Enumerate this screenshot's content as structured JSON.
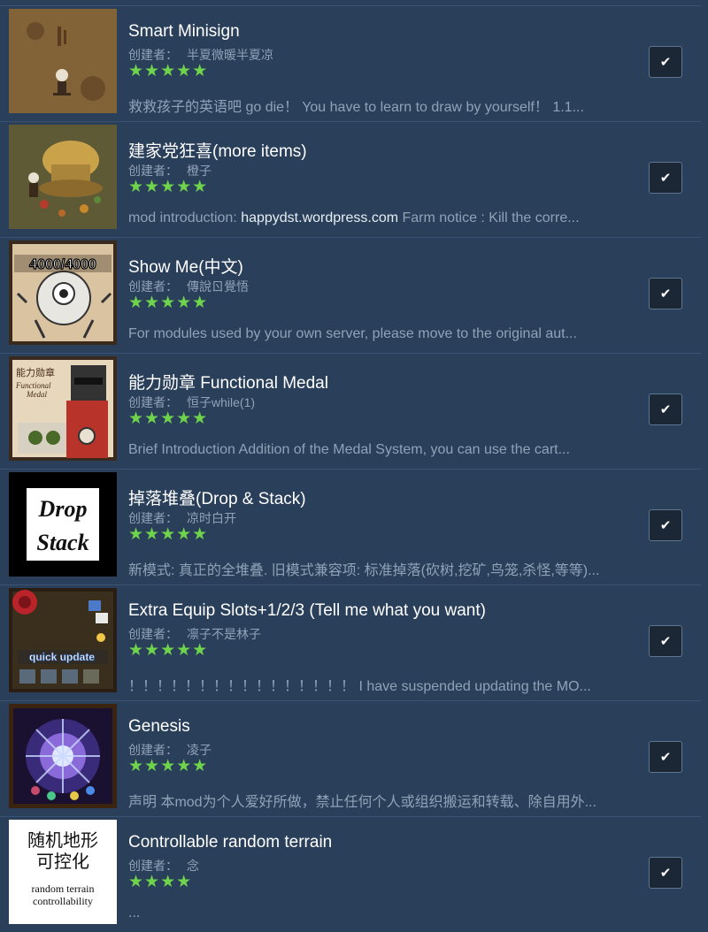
{
  "author_label": "创建者：",
  "check_glyph": "✔",
  "items": [
    {
      "title": "Smart Minisign",
      "author": "半夏微暖半夏凉",
      "stars": "★★★★★",
      "desc": "救救孩子的英语吧 go die！ You have to learn to draw by yourself！ 1.1...",
      "checked": true
    },
    {
      "title": "建家党狂喜(more items)",
      "author": "橙子",
      "stars": "★★★★★",
      "desc_prefix": "mod introduction: ",
      "desc_link": "happydst.wordpress.com",
      "desc_suffix": " Farm notice : Kill the corre...",
      "checked": true
    },
    {
      "title": "Show Me(中文)",
      "author": "傳說ㄖ覺悟",
      "stars": "★★★★★",
      "thumb_text": "4000/4000",
      "desc": "For modules used by your own server, please move to the original aut...",
      "checked": true
    },
    {
      "title": "能力勋章 Functional Medal",
      "author": "恒子while(1)",
      "stars": "★★★★★",
      "thumb_text_1": "能力勋章",
      "thumb_text_2": "Functional",
      "thumb_text_3": "Medal",
      "desc": "Brief Introduction Addition of the Medal System, you can use the cart...",
      "checked": true
    },
    {
      "title": "掉落堆叠(Drop & Stack)",
      "author": "凉时白开",
      "stars": "★★★★★",
      "thumb_text_1": "Drop",
      "thumb_text_2": "Stack",
      "desc": "新模式: 真正的全堆叠. 旧模式兼容项: 标准掉落(砍树,挖矿,鸟笼,杀怪,等等)...",
      "checked": true
    },
    {
      "title": "Extra Equip Slots+1/2/3 (Tell me what you want)",
      "author": "凛子不是林子",
      "stars": "★★★★★",
      "thumb_text": "quick update",
      "desc": "！！！！！！！！！！！！！！！！ I have suspended updating the MO...",
      "checked": true
    },
    {
      "title": "Genesis",
      "author": "凌子",
      "stars": "★★★★★",
      "desc": "声明 本mod为个人爱好所做，禁止任何个人或组织搬运和转载、除自用外...",
      "checked": true
    },
    {
      "title": "Controllable random terrain",
      "author": "念",
      "stars": "★★★★",
      "thumb_text_1": "随机地形",
      "thumb_text_2": "可控化",
      "thumb_text_3": "random terrain",
      "thumb_text_4": "controllability",
      "desc": "...",
      "checked": true
    }
  ]
}
